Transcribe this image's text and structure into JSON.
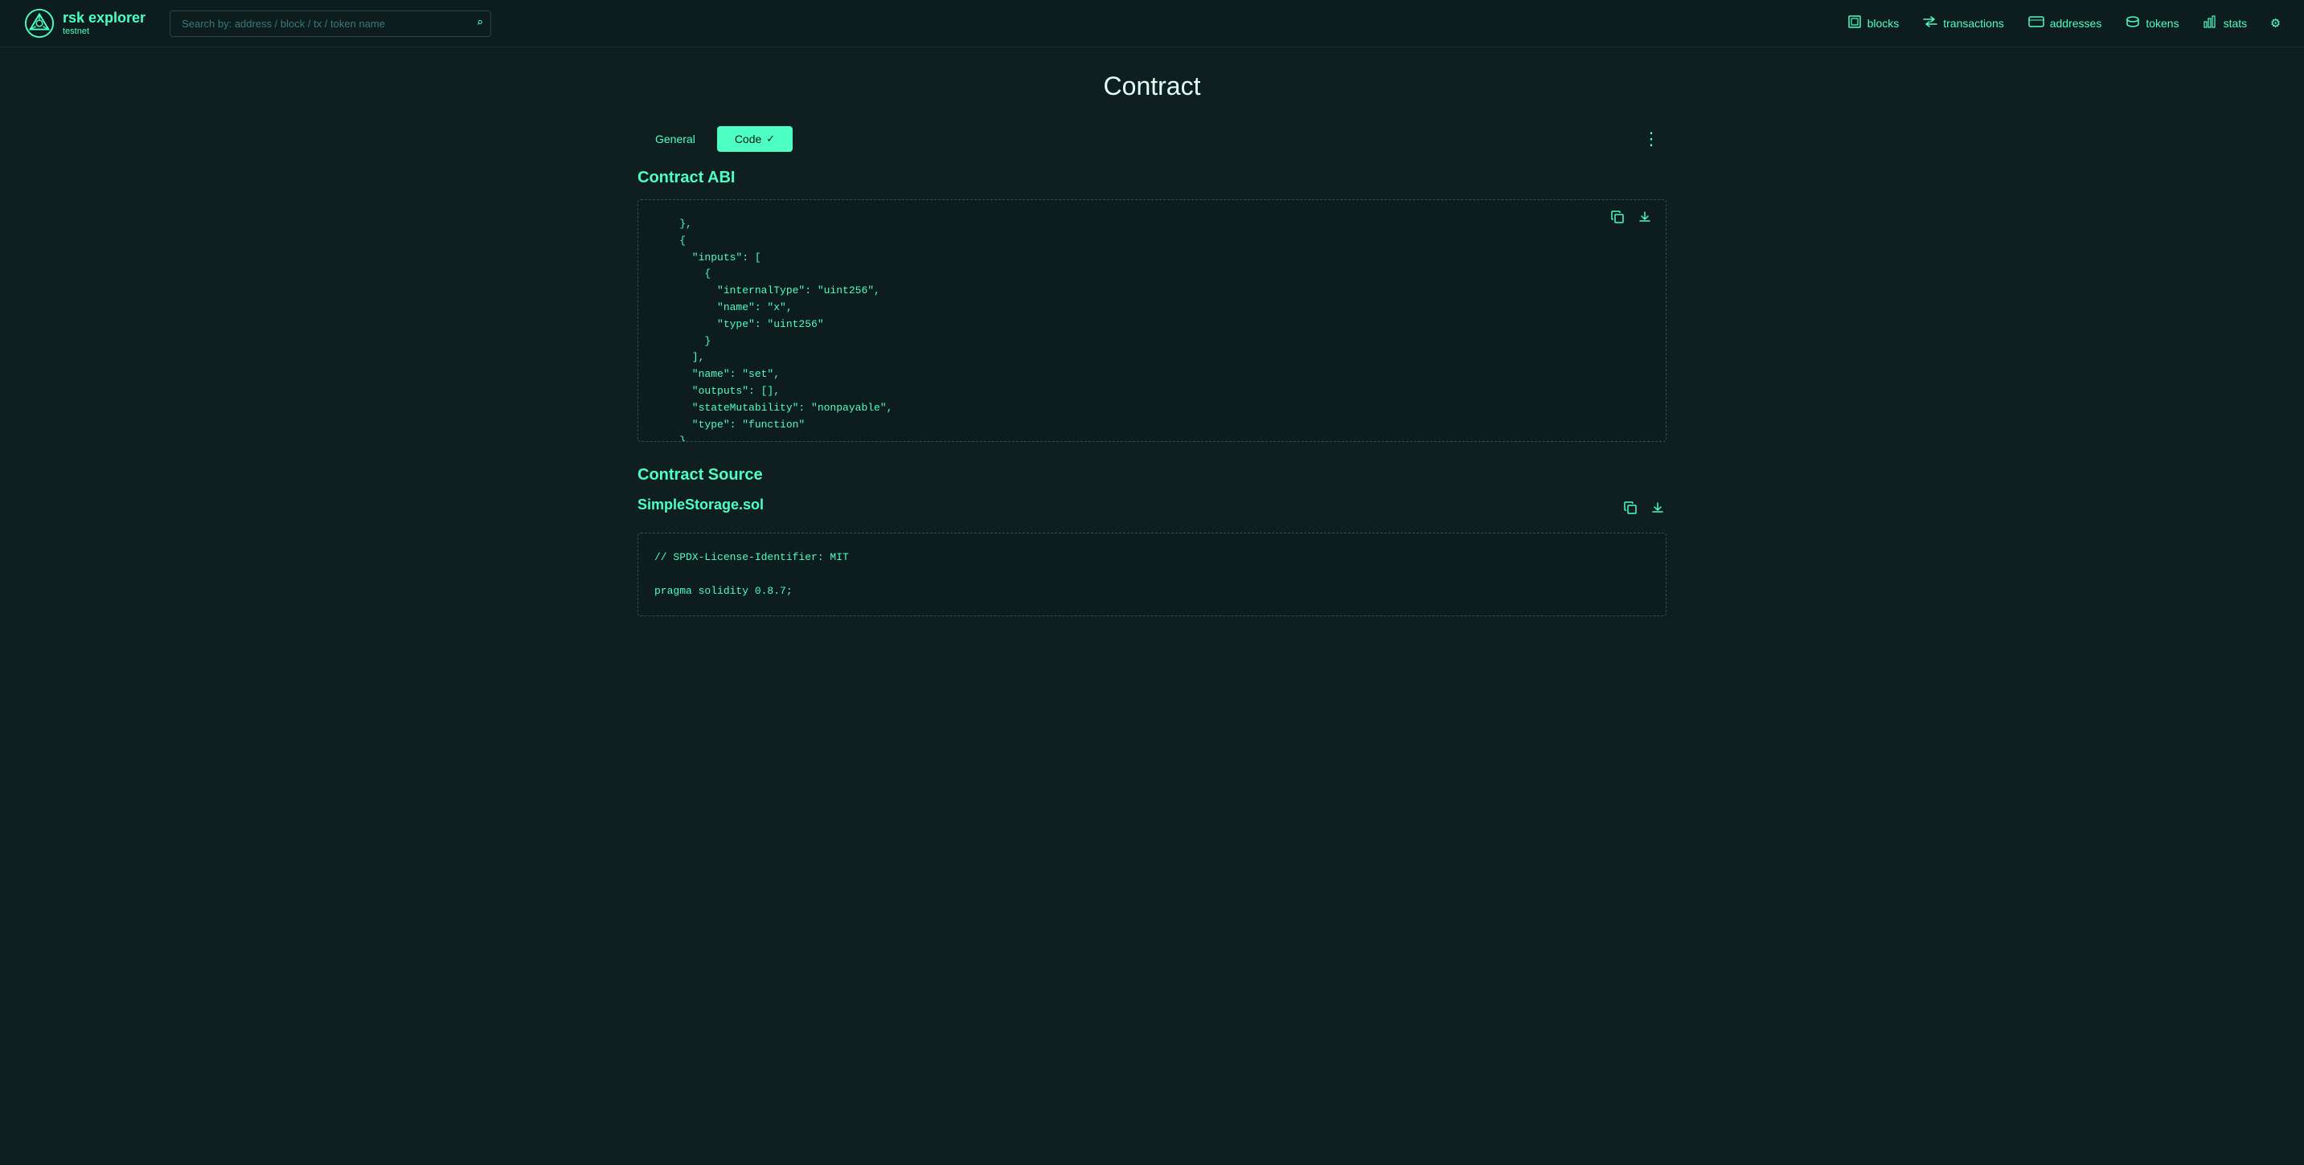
{
  "app": {
    "title": "rsk explorer",
    "subtitle": "testnet"
  },
  "navbar": {
    "search_placeholder": "Search by: address / block / tx / token name",
    "links": [
      {
        "label": "blocks",
        "icon": "◫"
      },
      {
        "label": "transactions",
        "icon": "⇄"
      },
      {
        "label": "addresses",
        "icon": "▭"
      },
      {
        "label": "tokens",
        "icon": "⊡"
      },
      {
        "label": "stats",
        "icon": "▦"
      }
    ]
  },
  "page": {
    "title": "Contract"
  },
  "tabs": [
    {
      "label": "General",
      "active": false
    },
    {
      "label": "Code",
      "active": true
    }
  ],
  "contract_abi": {
    "section_title": "Contract ABI",
    "code": "    },\n    {\n      \"inputs\": [\n        {\n          \"internalType\": \"uint256\",\n          \"name\": \"x\",\n          \"type\": \"uint256\"\n        }\n      ],\n      \"name\": \"set\",\n      \"outputs\": [],\n      \"stateMutability\": \"nonpayable\",\n      \"type\": \"function\"\n    }\n  ]"
  },
  "contract_source": {
    "section_title": "Contract Source",
    "file_name": "SimpleStorage.sol",
    "code": "// SPDX-License-Identifier: MIT\n\npragma solidity 0.8.7;"
  },
  "icons": {
    "search": "🔍",
    "copy": "⧉",
    "download": "⬇",
    "more": "⋮",
    "settings": "⚙",
    "check": "✓"
  }
}
